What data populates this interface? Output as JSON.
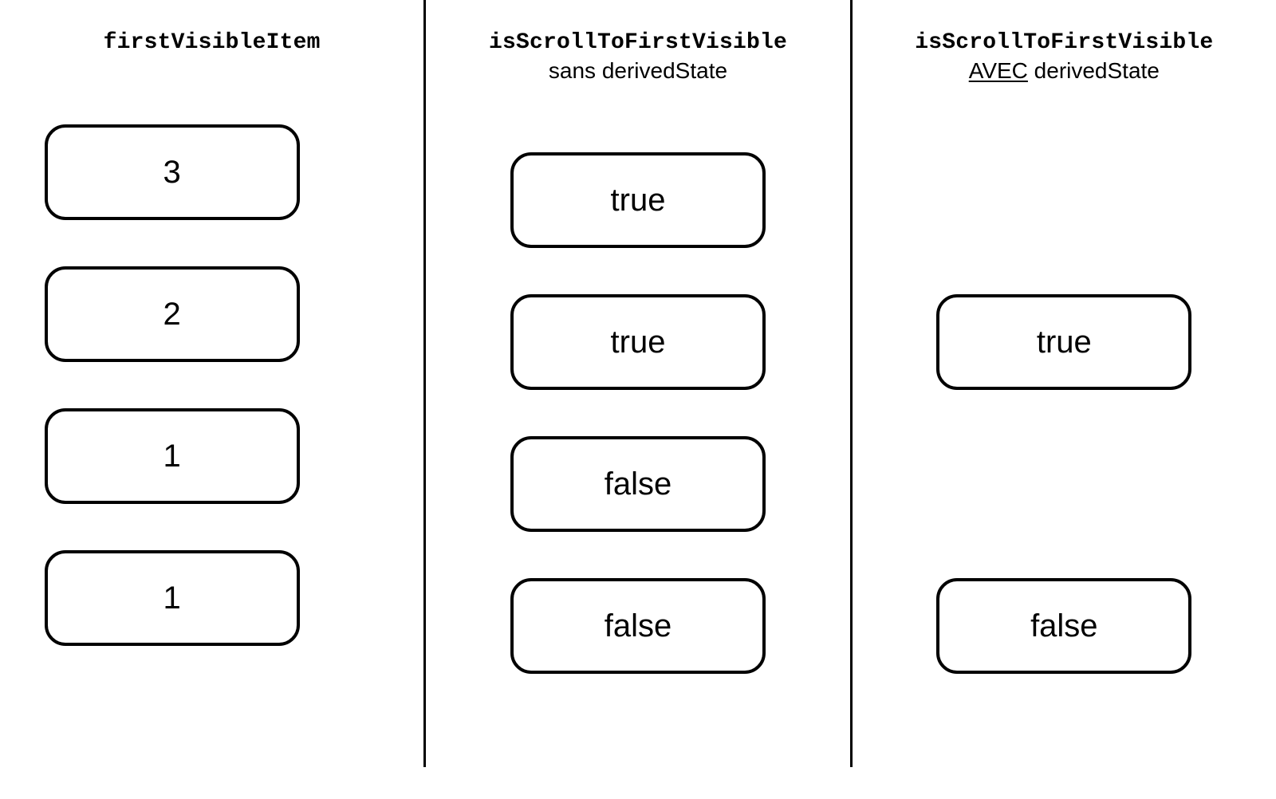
{
  "columns": {
    "col1": {
      "title_mono": "firstVisibleItem"
    },
    "col2": {
      "title_mono": "isScrollToFirstVisible",
      "subtitle_plain": "sans derivedState"
    },
    "col3": {
      "title_mono": "isScrollToFirstVisible",
      "subtitle_underlined": "AVEC",
      "subtitle_rest": " derivedState"
    }
  },
  "rows": {
    "col1": [
      "3",
      "2",
      "1",
      "1"
    ],
    "col2": [
      "true",
      "true",
      "false",
      "false"
    ],
    "col3": [
      null,
      "true",
      null,
      "false"
    ]
  }
}
